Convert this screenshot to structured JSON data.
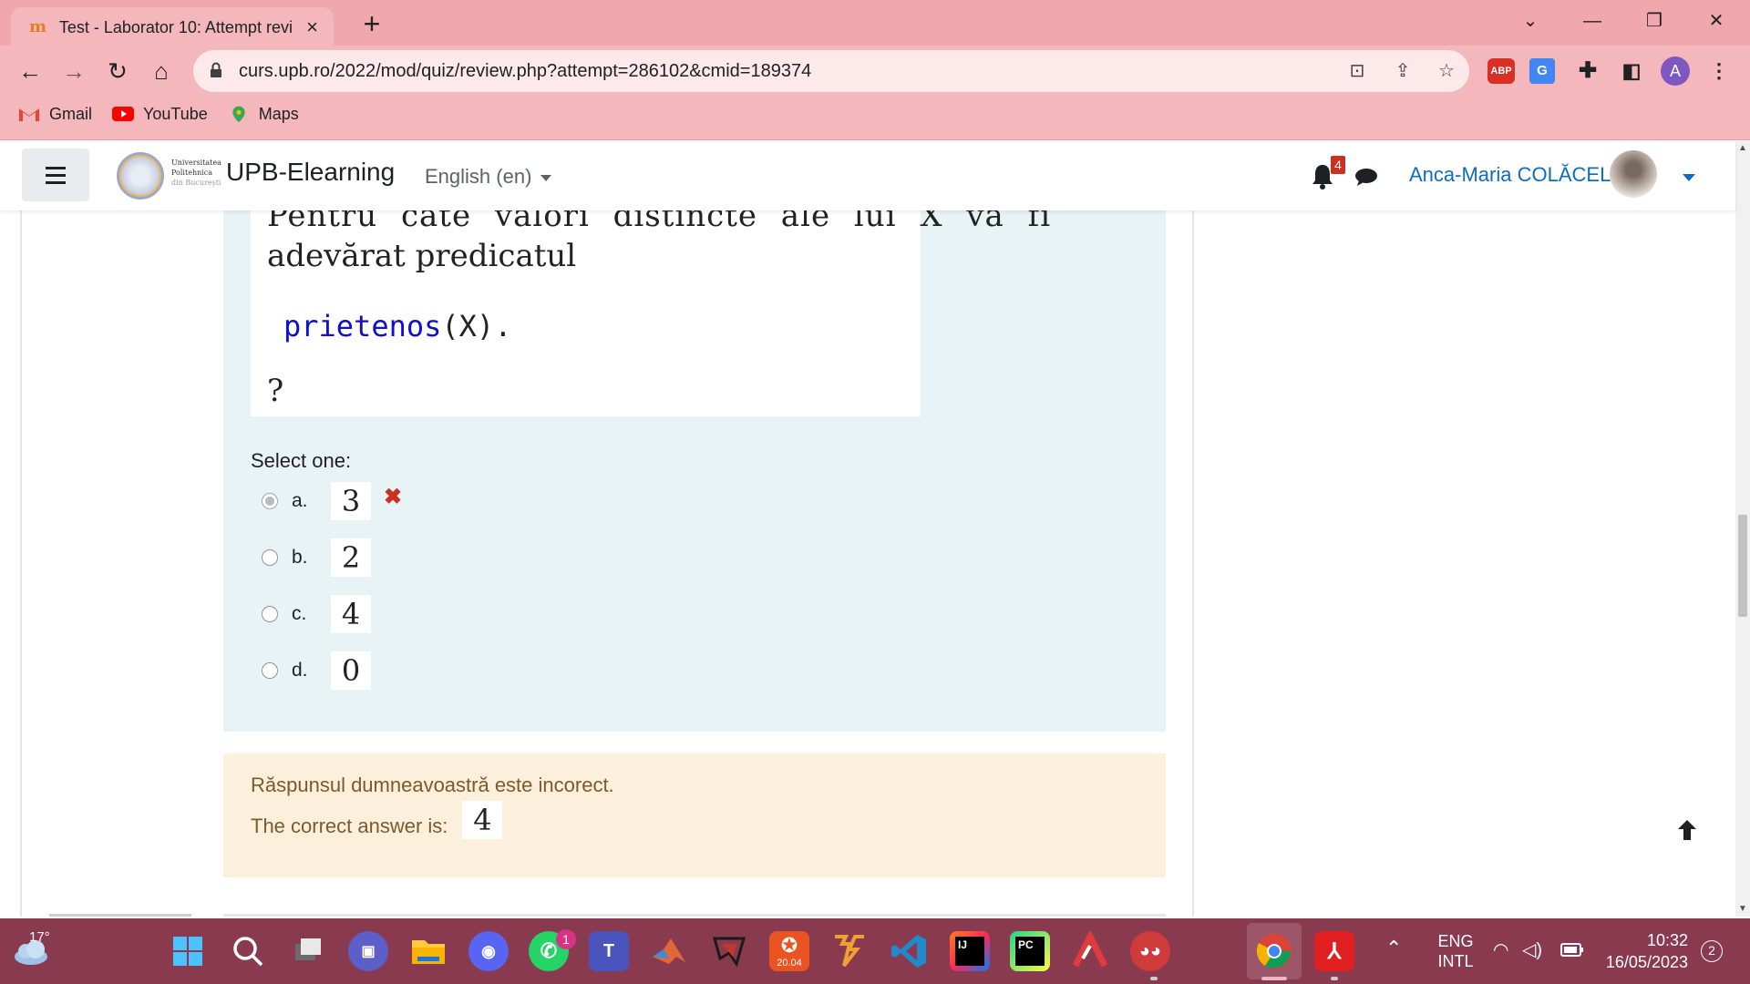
{
  "browser": {
    "tab_title": "Test - Laborator 10: Attempt revi",
    "url": "curs.upb.ro/2022/mod/quiz/review.php?attempt=286102&cmid=189374",
    "bookmarks": [
      {
        "label": "Gmail",
        "icon": "gmail-icon"
      },
      {
        "label": "YouTube",
        "icon": "youtube-icon"
      },
      {
        "label": "Maps",
        "icon": "maps-icon"
      }
    ],
    "extensions": {
      "adblock": "ABP",
      "profile_initial": "A"
    }
  },
  "navbar": {
    "logo_lines": [
      "Universitatea",
      "Politehnica",
      "din București"
    ],
    "site_name": "UPB-Elearning",
    "language": "English (en)",
    "notification_count": "4",
    "user_name": "Anca-Maria COLĂCEL"
  },
  "question": {
    "text_line1": "Pentru câte valori distincte ale lui X va fi",
    "text_line2": "adevărat predicatul",
    "code_pred": "prietenos",
    "code_var": "(X).",
    "question_mark": "?",
    "select_label": "Select one:",
    "options": [
      {
        "letter": "a.",
        "value": "3",
        "selected": true,
        "wrong": true
      },
      {
        "letter": "b.",
        "value": "2",
        "selected": false,
        "wrong": false
      },
      {
        "letter": "c.",
        "value": "4",
        "selected": false,
        "wrong": false
      },
      {
        "letter": "d.",
        "value": "0",
        "selected": false,
        "wrong": false
      }
    ],
    "wrong_mark": "✖"
  },
  "feedback": {
    "incorrect_text": "Răspunsul dumneavoastră este incorect.",
    "correct_label": "The correct answer is:",
    "correct_value": "4"
  },
  "taskbar": {
    "weather_temp": "17°",
    "whatsapp_badge": "1",
    "ubuntu_label": "20.04",
    "lang_line1": "ENG",
    "lang_line2": "INTL",
    "time": "10:32",
    "date": "16/05/2023",
    "notification_count": "2"
  },
  "colors": {
    "chrome_bg": "#f4b8bc",
    "question_bg": "#e7f3f5",
    "feedback_bg": "#fcefdc",
    "link_blue": "#0f6cbf",
    "taskbar_bg": "#8a3a4f"
  }
}
